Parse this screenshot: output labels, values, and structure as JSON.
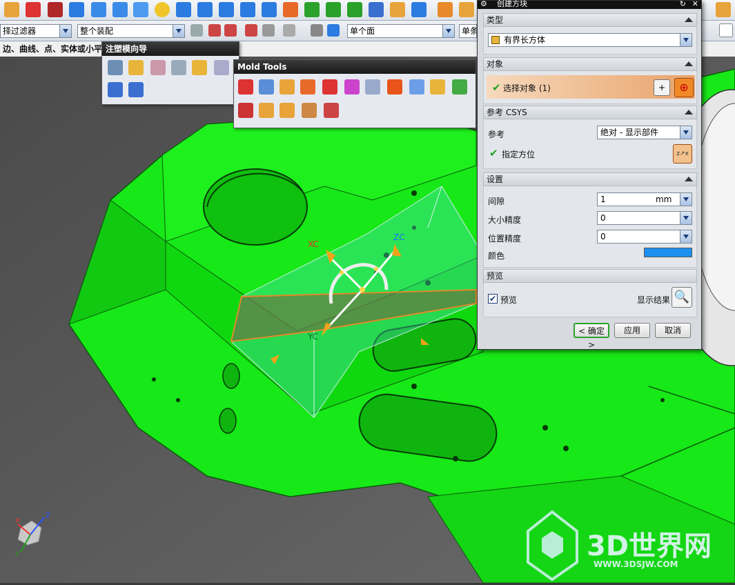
{
  "toolbar": {
    "selection_filter": "择过滤器",
    "assembly_scope": "整个装配",
    "face_rule": "单个面",
    "face_rule_2": "单条",
    "status_hint": "边、曲线、点、实体或小平"
  },
  "mold_wizard": {
    "title": "注塑模向导"
  },
  "mold_tools": {
    "title": "Mold Tools"
  },
  "viewport": {
    "axis_xc": "XC",
    "axis_yc": "YC",
    "axis_zc": "ZC",
    "triad_x": "X",
    "triad_y": "Y",
    "triad_z": "Z"
  },
  "watermark": {
    "brand": "3D世界网",
    "url": "WWW.3DSJW.COM"
  },
  "dialog": {
    "title": "创建方块",
    "type_section": {
      "label": "类型",
      "value": "有界长方体"
    },
    "object_section": {
      "label": "对象",
      "select_label": "选择对象 (1)"
    },
    "csys_section": {
      "label": "参考 CSYS",
      "ref_label": "参考",
      "ref_value": "绝对 - 显示部件",
      "orient_label": "指定方位"
    },
    "settings_section": {
      "label": "设置",
      "clearance_label": "间隙",
      "clearance_value": "1",
      "clearance_unit": "mm",
      "size_precision_label": "大小精度",
      "size_precision_value": "0",
      "pos_precision_label": "位置精度",
      "pos_precision_value": "0",
      "color_label": "颜色",
      "color_value": "#1e90f0"
    },
    "preview_section": {
      "label": "预览",
      "preview_label": "预览",
      "show_result_label": "显示结果"
    },
    "buttons": {
      "ok": "< 确定 >",
      "apply": "应用",
      "cancel": "取消"
    }
  },
  "colors": {
    "part_green": "#17e817",
    "accent_orange": "#f08a28"
  }
}
